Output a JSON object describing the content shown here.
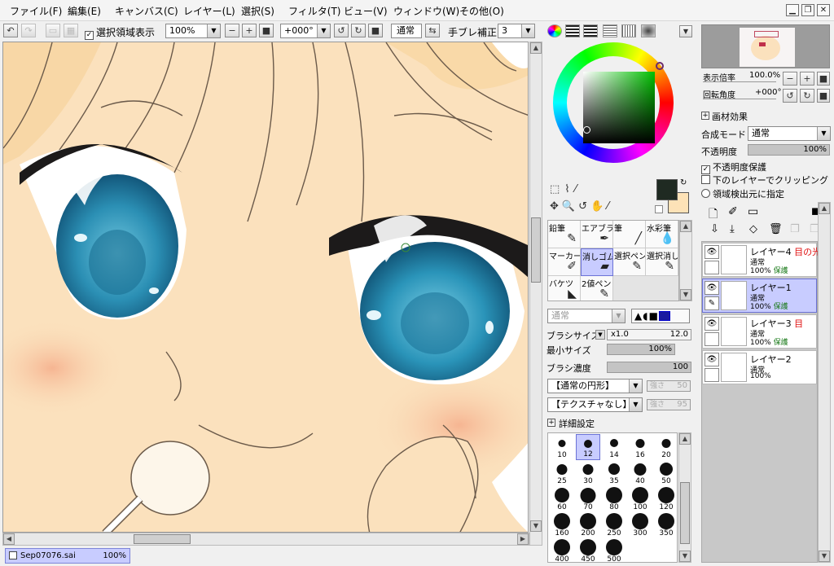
{
  "menu": [
    "ファイル(F)",
    "編集(E)",
    "キャンバス(C)",
    "レイヤー(L)",
    "選択(S)",
    "フィルタ(T)",
    "ビュー(V)",
    "ウィンドウ(W)",
    "その他(O)"
  ],
  "toolbar": {
    "selection_show_label": "選択領域表示",
    "zoom_value": "100%",
    "rotation_value": "+000°",
    "blend_label": "通常",
    "stabilizer_label": "手ブレ補正",
    "stabilizer_value": "3"
  },
  "document": {
    "filename": "Sep07076.sai",
    "zoom": "100%"
  },
  "navigator": {
    "zoom_label": "表示倍率",
    "zoom_value": "100.0%",
    "rotate_label": "回転角度",
    "rotate_value": "+000°"
  },
  "paper_effect": {
    "label": "画材効果"
  },
  "layer_props": {
    "blend_mode_label": "合成モード",
    "blend_mode_value": "通常",
    "opacity_label": "不透明度",
    "opacity_value": "100%",
    "preserve_opacity": "不透明度保護",
    "clipping": "下のレイヤーでクリッピング",
    "selection_source": "領域検出元に指定"
  },
  "layers": [
    {
      "name": "レイヤー4",
      "tag": "目の光",
      "mode": "通常",
      "opacity": "100%",
      "protect": "保護",
      "selected": false
    },
    {
      "name": "レイヤー1",
      "tag": "",
      "mode": "通常",
      "opacity": "100%",
      "protect": "保護",
      "selected": true
    },
    {
      "name": "レイヤー3",
      "tag": "目",
      "mode": "通常",
      "opacity": "100%",
      "protect": "保護",
      "selected": false
    },
    {
      "name": "レイヤー2",
      "tag": "",
      "mode": "通常",
      "opacity": "100%",
      "protect": "",
      "selected": false
    }
  ],
  "tools": [
    {
      "label": "鉛筆",
      "icon": "pencil-icon",
      "glyph": "✎"
    },
    {
      "label": "エアブラシ",
      "icon": "airbrush-icon",
      "glyph": "✒"
    },
    {
      "label": "筆",
      "icon": "brush-icon",
      "glyph": "╱"
    },
    {
      "label": "水彩筆",
      "icon": "watercolor-icon",
      "glyph": "💧"
    },
    {
      "label": "マーカー",
      "icon": "marker-icon",
      "glyph": "✐"
    },
    {
      "label": "消しゴム",
      "icon": "eraser-icon",
      "glyph": "▰"
    },
    {
      "label": "選択ペン",
      "icon": "select-pen-icon",
      "glyph": "✎"
    },
    {
      "label": "選択消し",
      "icon": "select-erase-icon",
      "glyph": "✎"
    },
    {
      "label": "バケツ",
      "icon": "bucket-icon",
      "glyph": "◣"
    },
    {
      "label": "2値ペン",
      "icon": "binary-pen-icon",
      "glyph": "✎"
    }
  ],
  "brush": {
    "mode_value": "通常",
    "size_label": "ブラシサイズ",
    "size_mult": "x1.0",
    "size_value": "12.0",
    "min_size_label": "最小サイズ",
    "min_size_value": "100%",
    "density_label": "ブラシ濃度",
    "density_value": "100",
    "shape_value": "【通常の円形】",
    "shape_strength_label": "強さ",
    "shape_strength_value": "50",
    "texture_value": "【テクスチャなし】",
    "texture_strength_label": "強さ",
    "texture_strength_value": "95",
    "details_label": "詳細設定"
  },
  "brush_sizes": [
    "10",
    "12",
    "14",
    "16",
    "20",
    "25",
    "30",
    "35",
    "40",
    "50",
    "60",
    "70",
    "80",
    "100",
    "120",
    "160",
    "200",
    "250",
    "300",
    "350",
    "400",
    "450",
    "500"
  ],
  "colors": {
    "primary": "#1f2a22",
    "secondary": "#fde2b7",
    "picker_hue": "#00c000",
    "selection": "#c8ccff"
  }
}
